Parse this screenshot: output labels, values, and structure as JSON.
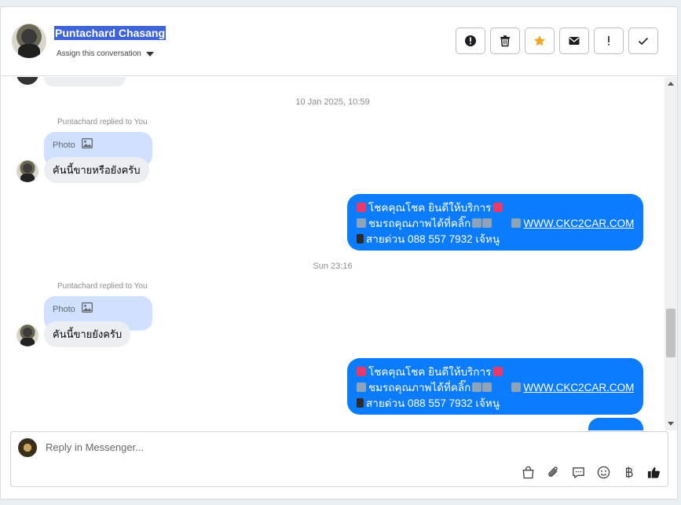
{
  "header": {
    "contact_name": "Puntachard Chasang",
    "assign_label": "Assign this conversation"
  },
  "thread": {
    "timestamp_1": "10 Jan 2025, 10:59",
    "replied_1": "Puntachard replied to You",
    "photo_label_1": "Photo",
    "incoming_1": "คันนี้ขายหรือยังครับ",
    "outgoing_1": {
      "line1": "โชคคุณโชค ยินดีให้บริการ",
      "line2": "ชมรถคุณภาพได้ที่คลิ๊ก",
      "link": "WWW.CKC2CAR.COM",
      "line3": "สายด่วน 088 557 7932 เจ้หนู"
    },
    "timestamp_2": "Sun 23:16",
    "replied_2": "Puntachard replied to You",
    "photo_label_2": "Photo",
    "incoming_2": "คันนี้ขายยังครับ",
    "outgoing_2": {
      "line1": "โชคคุณโชค ยินดีให้บริการ",
      "line2": "ชมรถคุณภาพได้ที่คลิ๊ก",
      "link": "WWW.CKC2CAR.COM",
      "line3": "สายด่วน 088 557 7932 เจ้หนู"
    }
  },
  "composer": {
    "placeholder": "Reply in Messenger..."
  },
  "icons": {
    "actions": [
      "alert-circle-icon",
      "trash-icon",
      "star-icon",
      "envelope-icon",
      "exclamation-icon",
      "check-icon"
    ],
    "composer_tools": [
      "shopping-bag-icon",
      "paperclip-icon",
      "saved-reply-icon",
      "emoji-icon",
      "baht-icon",
      "thumbs-up-icon"
    ]
  },
  "colors": {
    "accent_blue": "#0b7cff",
    "photo_bubble": "#cfe1ff",
    "star": "#f5a623"
  }
}
